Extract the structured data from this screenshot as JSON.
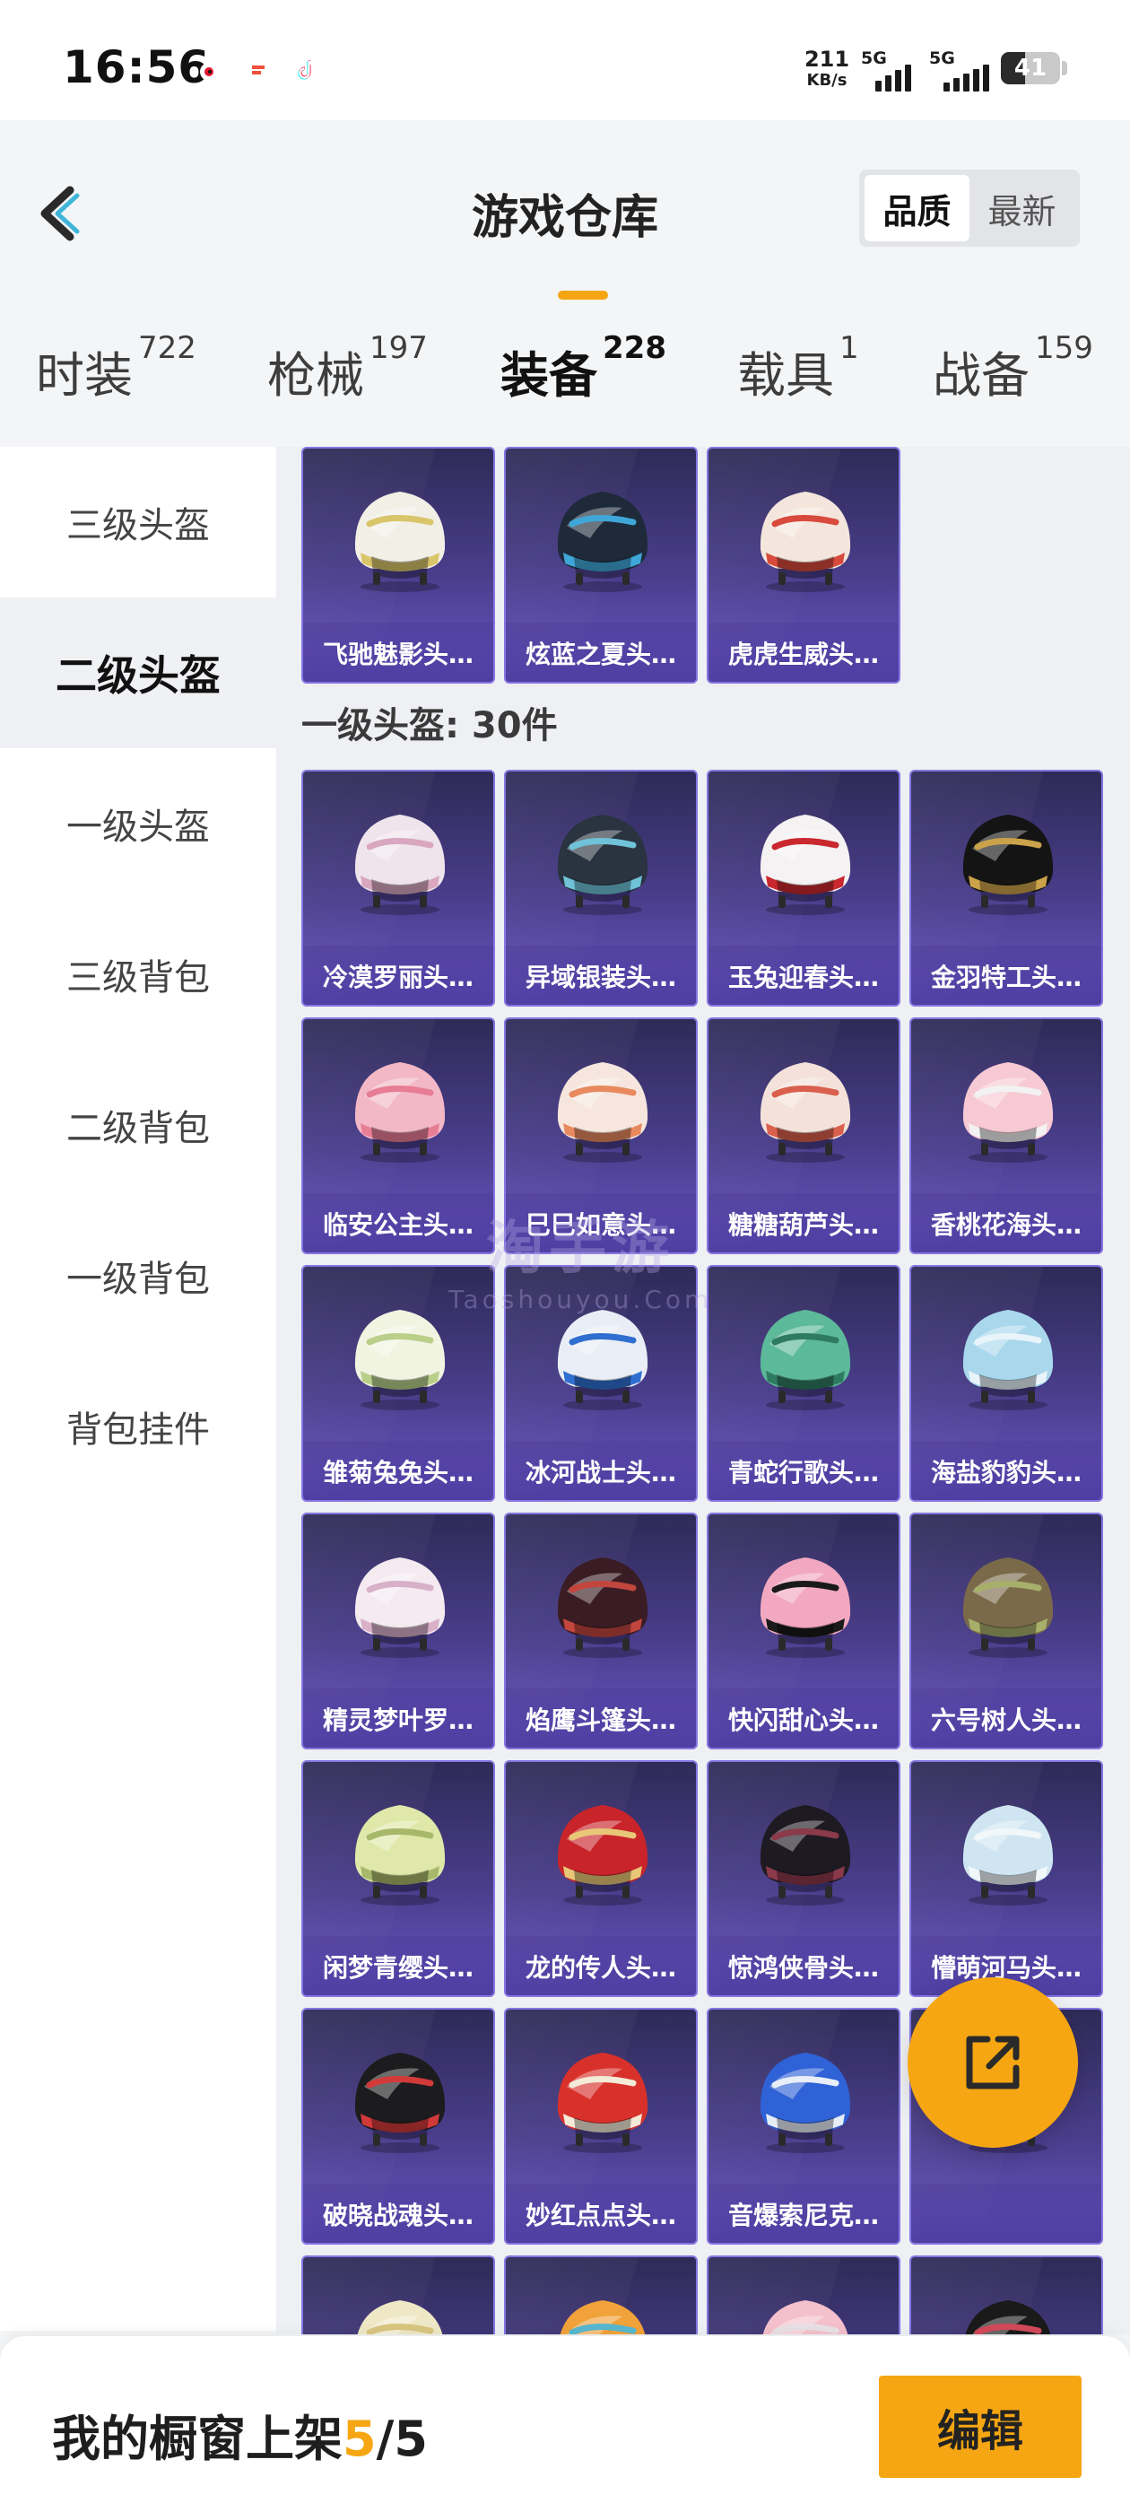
{
  "status_bar": {
    "time": "16:56",
    "net_speed": "211",
    "net_unit": "KB/s",
    "signal1": "5G",
    "signal2": "5G",
    "battery": "41",
    "apps": [
      {
        "icon": "weibo-icon",
        "color": "#f5a623"
      },
      {
        "icon": "app-icon",
        "color": "#f04f3a"
      },
      {
        "icon": "tiktok-icon",
        "color": "#111111"
      }
    ]
  },
  "header": {
    "title": "游戏仓库",
    "sort_options": [
      "品质",
      "最新"
    ],
    "sort_selected": "品质"
  },
  "tabs": [
    {
      "label": "时装",
      "count": "722"
    },
    {
      "label": "枪械",
      "count": "197"
    },
    {
      "label": "装备",
      "count": "228"
    },
    {
      "label": "载具",
      "count": "1"
    },
    {
      "label": "战备",
      "count": "159"
    }
  ],
  "active_tab": "装备",
  "sidebar": {
    "items": [
      "三级头盔",
      "二级头盔",
      "一级头盔",
      "三级背包",
      "二级背包",
      "一级背包",
      "背包挂件"
    ],
    "active": "二级头盔"
  },
  "section_prev_items": [
    "飞驰魅影头…",
    "炫蓝之夏头…",
    "虎虎生威头…"
  ],
  "section": {
    "title": "一级头盔: 30件",
    "items": [
      "冷漠罗丽头…",
      "异域银装头…",
      "玉兔迎春头…",
      "金羽特工头…",
      "临安公主头…",
      "巳巳如意头…",
      "糖糖葫芦头…",
      "香桃花海头…",
      "雏菊兔兔头…",
      "冰河战士头…",
      "青蛇行歌头…",
      "海盐豹豹头…",
      "精灵梦叶罗…",
      "焰鹰斗篷头…",
      "快闪甜心头…",
      "六号树人头…",
      "闲梦青缨头…",
      "龙的传人头…",
      "惊鸿侠骨头…",
      "懵萌河马头…",
      "破晓战魂头…",
      "妙红点点头…",
      "音爆索尼克…",
      ""
    ]
  },
  "helmet_colors": {
    "prev": [
      [
        "#f2efe6",
        "#d9c56a"
      ],
      [
        "#1e2a3a",
        "#3fa6d8"
      ],
      [
        "#f4e6dc",
        "#d84a3c"
      ]
    ],
    "grid": [
      [
        "#f0e4ec",
        "#d9a8c0"
      ],
      [
        "#2a3340",
        "#6fc2d8"
      ],
      [
        "#f4f2f2",
        "#c9282e"
      ],
      [
        "#141414",
        "#caa24a"
      ],
      [
        "#f2b8c6",
        "#e87d96"
      ],
      [
        "#f6e6de",
        "#e8895e"
      ],
      [
        "#f4e2da",
        "#d9604c"
      ],
      [
        "#f7c9d4",
        "#f2f2f2"
      ],
      [
        "#f2f4e2",
        "#b9cf8a"
      ],
      [
        "#e9eef6",
        "#2f6fcf"
      ],
      [
        "#5cb99a",
        "#2f7a62"
      ],
      [
        "#a9d7ec",
        "#e8f4fa"
      ],
      [
        "#f4eaf0",
        "#d8b0c8"
      ],
      [
        "#3a1c24",
        "#c2463e"
      ],
      [
        "#f2a8c0",
        "#1a1a1a"
      ],
      [
        "#7b6a4a",
        "#a7b06a"
      ],
      [
        "#dfe8a8",
        "#a8b86a"
      ],
      [
        "#c8242a",
        "#e8c878"
      ],
      [
        "#1e1a22",
        "#8a3a4a"
      ],
      [
        "#cfe6f2",
        "#f2f8fa"
      ],
      [
        "#1c1c1e",
        "#d23a3a"
      ],
      [
        "#d8312b",
        "#f4ead8"
      ],
      [
        "#2f62d6",
        "#e8eef8"
      ],
      [
        "#d42a2a",
        "#e89a60"
      ]
    ]
  },
  "bottom_bar": {
    "prefix": "我的橱窗上架",
    "count": "5",
    "separator": "/",
    "total": "5",
    "edit_label": "编辑"
  },
  "watermark": {
    "line1": "淘手游",
    "line2": "Taoshouyou.Com"
  }
}
